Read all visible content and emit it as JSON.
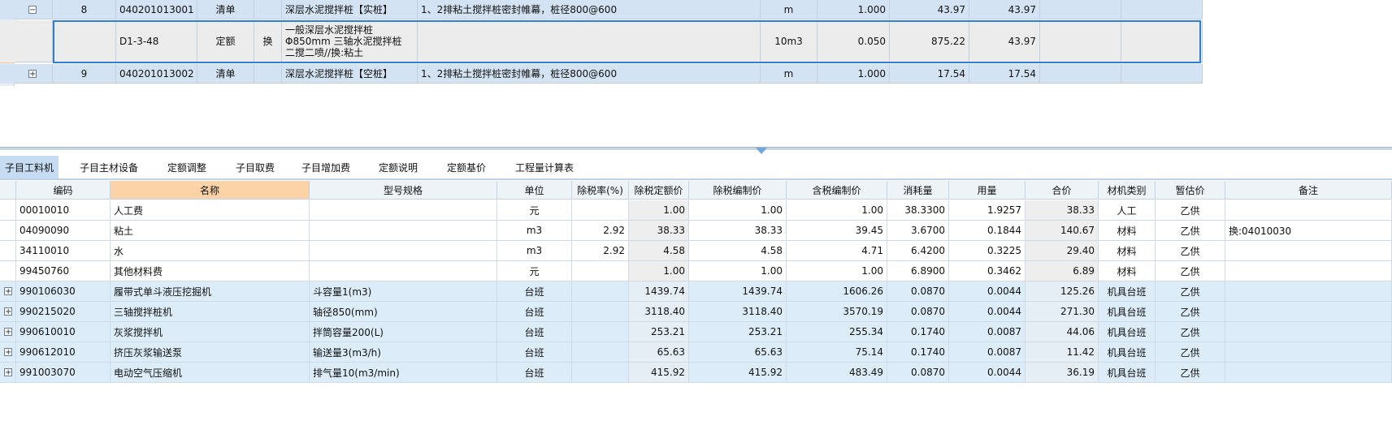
{
  "top_rows": [
    {
      "type": "item",
      "expander": "−",
      "seq": "8",
      "code": "040201013001",
      "category": "清单",
      "swap": "",
      "name": "深层水泥搅拌桩【实桩】",
      "feature": "1、2排粘土搅拌桩密封帷幕，桩径800@600",
      "unit": "m",
      "quantity": "1.000",
      "unit_price": "43.97",
      "total": "43.97"
    },
    {
      "type": "quota",
      "expander": "",
      "seq": "",
      "code": "D1-3-48",
      "category": "定额",
      "swap": "换",
      "name": "一般深层水泥搅拌桩 Φ850mm 三轴水泥搅拌桩 二搅二喷//换:粘土",
      "feature": "",
      "unit": "10m3",
      "quantity": "0.050",
      "unit_price": "875.22",
      "total": "43.97"
    },
    {
      "type": "item",
      "expander": "+",
      "seq": "9",
      "code": "040201013002",
      "category": "清单",
      "swap": "",
      "name": "深层水泥搅拌桩【空桩】",
      "feature": "1、2排粘土搅拌桩密封帷幕，桩径800@600",
      "unit": "m",
      "quantity": "1.000",
      "unit_price": "17.54",
      "total": "17.54"
    }
  ],
  "tabs": [
    "子目工料机",
    "子目主材设备",
    "定额调整",
    "子目取费",
    "子目增加费",
    "定额说明",
    "定额基价",
    "工程量计算表"
  ],
  "columns": [
    "编码",
    "名称",
    "型号规格",
    "单位",
    "除税率(%)",
    "除税定额价",
    "除税编制价",
    "含税编制价",
    "消耗量",
    "用量",
    "合价",
    "材机类别",
    "暂估价",
    "备注"
  ],
  "rows": [
    {
      "expand": false,
      "code": "00010010",
      "name": "人工费",
      "spec": "",
      "unit": "元",
      "tax_rate": "",
      "base_price": "1.00",
      "compile_price": "1.00",
      "tax_incl_price": "1.00",
      "consumption": "38.3300",
      "usage": "1.9257",
      "total": "38.33",
      "category": "人工",
      "estimate": "乙供",
      "remark": ""
    },
    {
      "expand": false,
      "code": "04090090",
      "name": "粘土",
      "spec": "",
      "unit": "m3",
      "tax_rate": "2.92",
      "base_price": "38.33",
      "compile_price": "38.33",
      "tax_incl_price": "39.45",
      "consumption": "3.6700",
      "usage": "0.1844",
      "total": "140.67",
      "category": "材料",
      "estimate": "乙供",
      "remark": "换:04010030"
    },
    {
      "expand": false,
      "code": "34110010",
      "name": "水",
      "spec": "",
      "unit": "m3",
      "tax_rate": "2.92",
      "base_price": "4.58",
      "compile_price": "4.58",
      "tax_incl_price": "4.71",
      "consumption": "6.4200",
      "usage": "0.3225",
      "total": "29.40",
      "category": "材料",
      "estimate": "乙供",
      "remark": ""
    },
    {
      "expand": false,
      "code": "99450760",
      "name": "其他材料费",
      "spec": "",
      "unit": "元",
      "tax_rate": "",
      "base_price": "1.00",
      "compile_price": "1.00",
      "tax_incl_price": "1.00",
      "consumption": "6.8900",
      "usage": "0.3462",
      "total": "6.89",
      "category": "材料",
      "estimate": "乙供",
      "remark": ""
    },
    {
      "expand": true,
      "code": "990106030",
      "name": "履带式单斗液压挖掘机",
      "spec": "斗容量1(m3)",
      "unit": "台班",
      "tax_rate": "",
      "base_price": "1439.74",
      "compile_price": "1439.74",
      "tax_incl_price": "1606.26",
      "consumption": "0.0870",
      "usage": "0.0044",
      "total": "125.26",
      "category": "机具台班",
      "estimate": "乙供",
      "remark": ""
    },
    {
      "expand": true,
      "code": "990215020",
      "name": "三轴搅拌桩机",
      "spec": "轴径850(mm)",
      "unit": "台班",
      "tax_rate": "",
      "base_price": "3118.40",
      "compile_price": "3118.40",
      "tax_incl_price": "3570.19",
      "consumption": "0.0870",
      "usage": "0.0044",
      "total": "271.30",
      "category": "机具台班",
      "estimate": "乙供",
      "remark": ""
    },
    {
      "expand": true,
      "code": "990610010",
      "name": "灰浆搅拌机",
      "spec": "拌筒容量200(L)",
      "unit": "台班",
      "tax_rate": "",
      "base_price": "253.21",
      "compile_price": "253.21",
      "tax_incl_price": "255.34",
      "consumption": "0.1740",
      "usage": "0.0087",
      "total": "44.06",
      "category": "机具台班",
      "estimate": "乙供",
      "remark": ""
    },
    {
      "expand": true,
      "code": "990612010",
      "name": "挤压灰浆输送泵",
      "spec": "输送量3(m3/h)",
      "unit": "台班",
      "tax_rate": "",
      "base_price": "65.63",
      "compile_price": "65.63",
      "tax_incl_price": "75.14",
      "consumption": "0.1740",
      "usage": "0.0087",
      "total": "11.42",
      "category": "机具台班",
      "estimate": "乙供",
      "remark": ""
    },
    {
      "expand": true,
      "code": "991003070",
      "name": "电动空气压缩机",
      "spec": "排气量10(m3/min)",
      "unit": "台班",
      "tax_rate": "",
      "base_price": "415.92",
      "compile_price": "415.92",
      "tax_incl_price": "483.49",
      "consumption": "0.0870",
      "usage": "0.0044",
      "total": "36.19",
      "category": "机具台班",
      "estimate": "乙供",
      "remark": ""
    }
  ],
  "colors": {
    "item_row": "#d4e3f4",
    "machine_row": "#dcecf9",
    "name_header": "#fbd3a7",
    "active_tab": "#c6dcf3",
    "selection": "#2f7fd4"
  }
}
